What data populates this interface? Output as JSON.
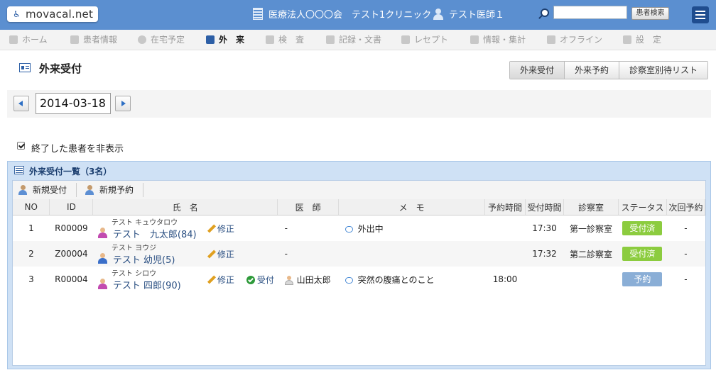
{
  "header": {
    "logo": "movacal.net",
    "clinic": "医療法人〇〇〇会　テスト1クリニック",
    "doctor": "テスト医師１",
    "search_placeholder": "",
    "search_button": "患者検索"
  },
  "nav": {
    "items": [
      {
        "label": "ホーム",
        "icon": "home-icon"
      },
      {
        "label": "患者情報",
        "icon": "users-icon"
      },
      {
        "label": "在宅予定",
        "icon": "clock-icon"
      },
      {
        "label": "外　来",
        "icon": "id-card-icon"
      },
      {
        "label": "検　査",
        "icon": "chart-icon"
      },
      {
        "label": "記録・文書",
        "icon": "document-icon"
      },
      {
        "label": "レセプト",
        "icon": "receipt-icon"
      },
      {
        "label": "情報・集計",
        "icon": "monitor-icon"
      },
      {
        "label": "オフライン",
        "icon": "offline-icon"
      },
      {
        "label": "設　定",
        "icon": "tools-icon"
      }
    ]
  },
  "page": {
    "title": "外来受付",
    "tabs": [
      "外来受付",
      "外来予約",
      "診察室別待リスト"
    ],
    "date": "2014-03-18",
    "hide_finished_label": "終了した患者を非表示",
    "hide_finished_checked": true
  },
  "panel": {
    "title": "外来受付一覧（3名）",
    "toolbar": [
      "新規受付",
      "新規予約"
    ],
    "columns": [
      "NO",
      "ID",
      "氏　名",
      "医　師",
      "メ　モ",
      "予約時間",
      "受付時間",
      "診察室",
      "ステータス",
      "次回予約"
    ],
    "edit_label": "修正",
    "accept_label": "受付",
    "rows": [
      {
        "no": "1",
        "id": "R00009",
        "kana": "テスト キュウタロウ",
        "name": "テスト　九太郎(84)",
        "gender": "female",
        "doctor": "-",
        "doctor_icon": false,
        "memo": "外出中",
        "memo_icon": true,
        "reserve_time": "",
        "accept_time": "17:30",
        "room": "第一診察室",
        "status": "受付済",
        "status_type": "done",
        "status_color": "#8ccc3f",
        "next": "-",
        "accept_action": false
      },
      {
        "no": "2",
        "id": "Z00004",
        "kana": "テスト ヨウジ",
        "name": "テスト 幼児(5)",
        "gender": "male",
        "doctor": "-",
        "doctor_icon": false,
        "memo": "",
        "memo_icon": false,
        "reserve_time": "",
        "accept_time": "17:32",
        "room": "第二診察室",
        "status": "受付済",
        "status_type": "done",
        "status_color": "#8ccc3f",
        "next": "-",
        "accept_action": false
      },
      {
        "no": "3",
        "id": "R00004",
        "kana": "テスト シロウ",
        "name": "テスト 四郎(90)",
        "gender": "female",
        "doctor": "山田太郎",
        "doctor_icon": true,
        "memo": "突然の腹痛とのこと",
        "memo_icon": true,
        "reserve_time": "18:00",
        "accept_time": "",
        "room": "",
        "status": "予約",
        "status_type": "rsv",
        "status_color": "#8aaed6",
        "next": "-",
        "accept_action": true
      }
    ]
  }
}
